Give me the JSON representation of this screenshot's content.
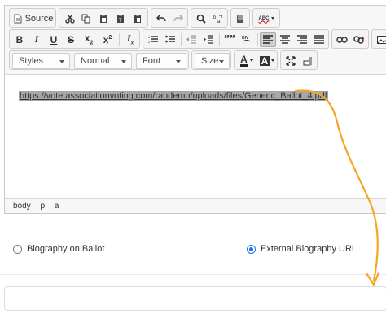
{
  "toolbar": {
    "source_label": "Source",
    "styles_label": "Styles",
    "format_label": "Normal",
    "font_label": "Font",
    "size_label": "Size",
    "text_color_letter": "A",
    "bg_color_letter": "A",
    "spell_letters": "ABC"
  },
  "editor": {
    "link_text": "https://vote.associationvoting.com/rahdemo/uploads/files/Generic_Ballot_4.pdf",
    "path": [
      "body",
      "p",
      "a"
    ]
  },
  "options": {
    "biography_on_ballot": "Biography on Ballot",
    "external_biography_url": "External Biography URL",
    "selected": "external_biography_url"
  },
  "url_field": {
    "value": ""
  },
  "colors": {
    "arrow": "#f5a623",
    "radio_selected": "#1a73e8"
  }
}
